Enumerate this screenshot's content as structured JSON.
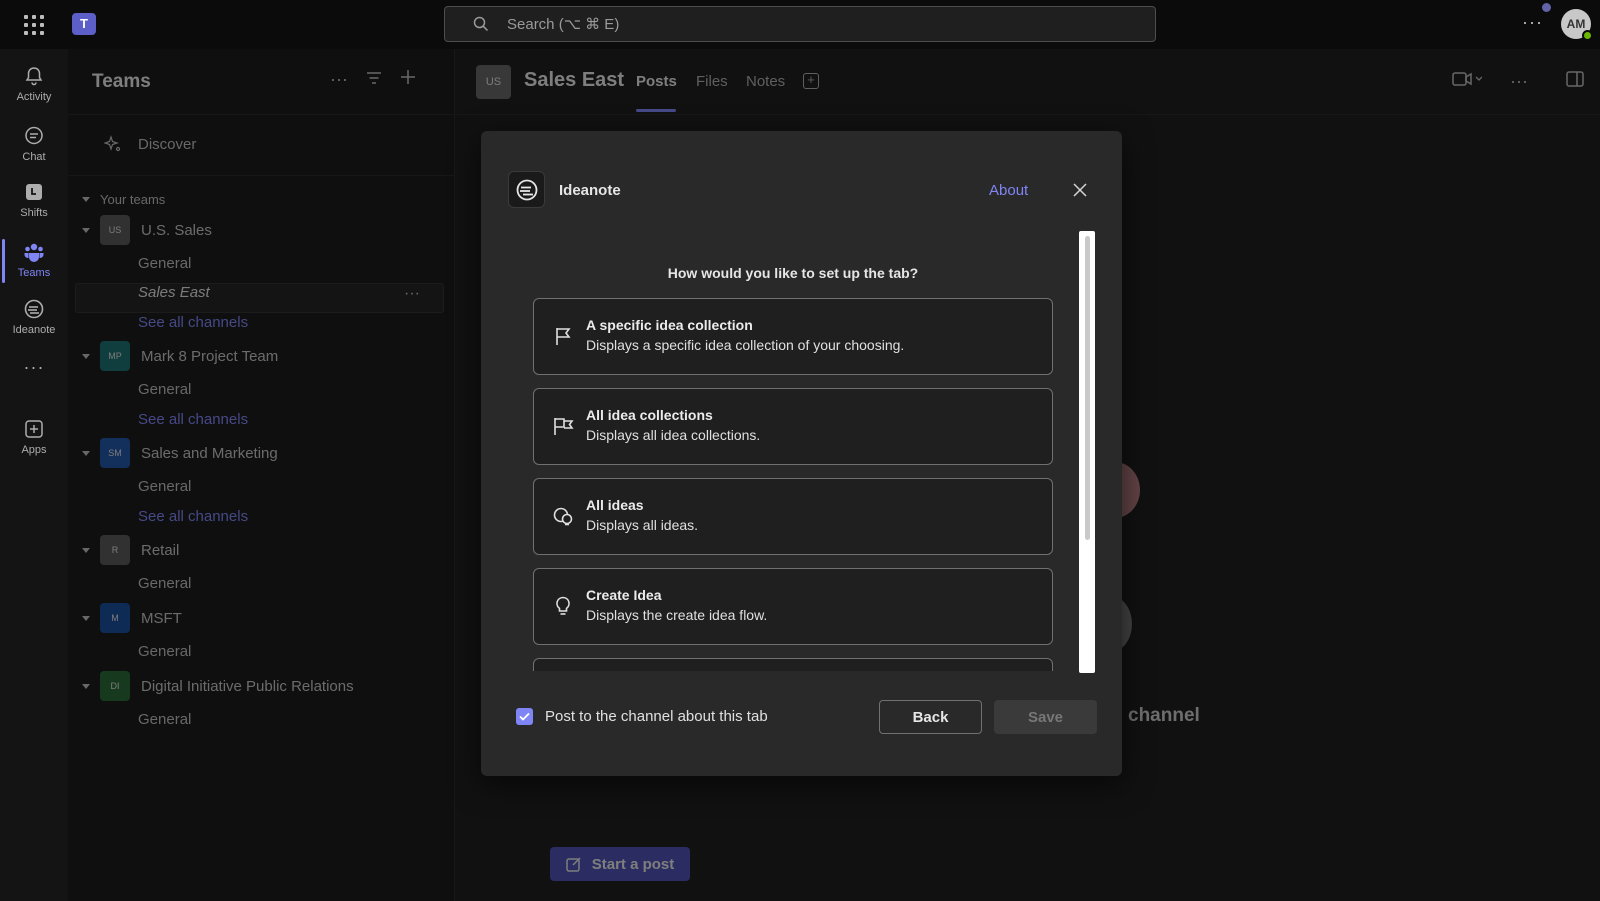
{
  "topbar": {
    "search_placeholder": "Search (⌥ ⌘ E)",
    "avatar_initials": "AM",
    "more_label": "···"
  },
  "rail": {
    "items": [
      {
        "label": "Activity",
        "icon": "bell-icon"
      },
      {
        "label": "Chat",
        "icon": "chat-icon"
      },
      {
        "label": "Shifts",
        "icon": "shifts-icon"
      },
      {
        "label": "Teams",
        "icon": "teams-icon",
        "active": true
      },
      {
        "label": "Ideanote",
        "icon": "ideanote-icon"
      },
      {
        "label": "Apps",
        "icon": "apps-icon"
      }
    ]
  },
  "sidepane": {
    "title": "Teams",
    "discover_label": "Discover",
    "your_teams_label": "Your teams",
    "teams": [
      {
        "initials": "US",
        "name": "U.S. Sales",
        "color": "#5a5a5a",
        "channels": [
          "General",
          "Sales East"
        ],
        "see_all": "See all channels"
      },
      {
        "initials": "MP",
        "name": "Mark 8 Project Team",
        "color": "#1e6f70",
        "channels": [
          "General"
        ],
        "see_all": "See all channels"
      },
      {
        "initials": "SM",
        "name": "Sales and Marketing",
        "color": "#2458a8",
        "channels": [
          "General"
        ],
        "see_all": "See all channels"
      },
      {
        "initials": "R",
        "name": "Retail",
        "color": "#5a5a5a",
        "channels": [
          "General"
        ]
      },
      {
        "initials": "M",
        "name": "MSFT",
        "color": "#1a4f9c",
        "channels": [
          "General"
        ]
      },
      {
        "initials": "DI",
        "name": "Digital Initiative Public Relations",
        "color": "#2a6b3a",
        "channels": [
          "General"
        ]
      }
    ]
  },
  "channel": {
    "avatar_initials": "US",
    "title": "Sales East",
    "tabs": [
      "Posts",
      "Files",
      "Notes"
    ],
    "active_tab": "Posts",
    "background_text": "channel",
    "start_post_label": "Start a post"
  },
  "dialog": {
    "app_name": "Ideanote",
    "about_label": "About",
    "question": "How would you like to set up the tab?",
    "options": [
      {
        "title": "A specific idea collection",
        "desc": "Displays a specific idea collection of your choosing.",
        "icon": "flag-icon"
      },
      {
        "title": "All idea collections",
        "desc": "Displays all idea collections.",
        "icon": "flags-icon"
      },
      {
        "title": "All ideas",
        "desc": "Displays all ideas.",
        "icon": "ideas-icon"
      },
      {
        "title": "Create Idea",
        "desc": "Displays the create idea flow.",
        "icon": "lightbulb-icon"
      }
    ],
    "post_to_channel_label": "Post to the channel about this tab",
    "post_to_channel_checked": true,
    "back_label": "Back",
    "save_label": "Save"
  },
  "colors": {
    "accent": "#7f85f5",
    "primary_button": "#4f52b2"
  }
}
